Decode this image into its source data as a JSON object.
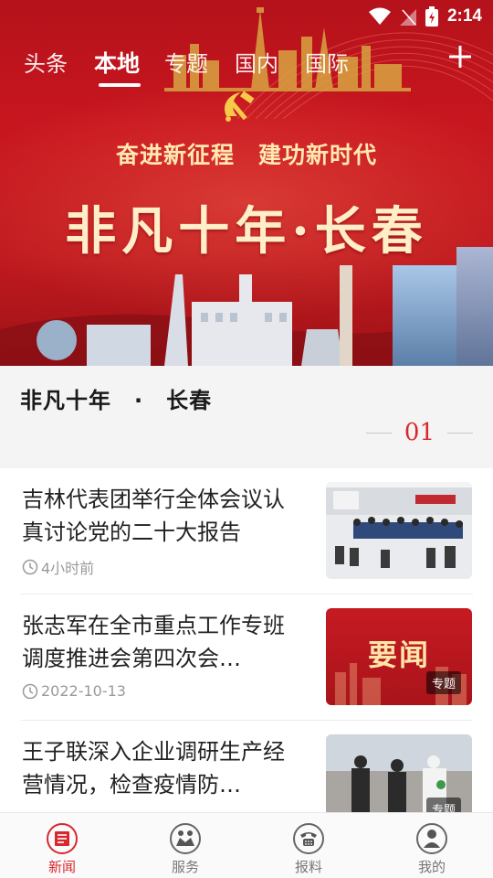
{
  "status_bar": {
    "time": "2:14"
  },
  "tabs": {
    "items": [
      {
        "label": "头条",
        "active": false
      },
      {
        "label": "本地",
        "active": true
      },
      {
        "label": "专题",
        "active": false
      },
      {
        "label": "国内",
        "active": false
      },
      {
        "label": "国际",
        "active": false
      }
    ],
    "add_icon": "plus-icon"
  },
  "hero": {
    "slogan": "奋进新征程　建功新时代",
    "title": "非凡十年·长春"
  },
  "carousel": {
    "caption": "非凡十年　·　长春",
    "page": "01"
  },
  "news": [
    {
      "title": "吉林代表团举行全体会议认真讨论党的二十大报告",
      "time": "4小时前",
      "tag": ""
    },
    {
      "title": "张志军在全市重点工作专班调度推进会第四次会…",
      "time": "2022-10-13",
      "tag": "专题",
      "thumb_text": "要闻"
    },
    {
      "title": "王子联深入企业调研生产经营情况，检查疫情防…",
      "time": "",
      "tag": "专题"
    }
  ],
  "bottom_nav": [
    {
      "label": "新闻",
      "icon": "newspaper-icon",
      "active": true
    },
    {
      "label": "服务",
      "icon": "handshake-icon",
      "active": false
    },
    {
      "label": "报料",
      "icon": "phone-icon",
      "active": false
    },
    {
      "label": "我的",
      "icon": "person-icon",
      "active": false
    }
  ],
  "colors": {
    "accent": "#d8282e",
    "hero_red": "#c8161f",
    "gold": "#ffe9b0"
  }
}
